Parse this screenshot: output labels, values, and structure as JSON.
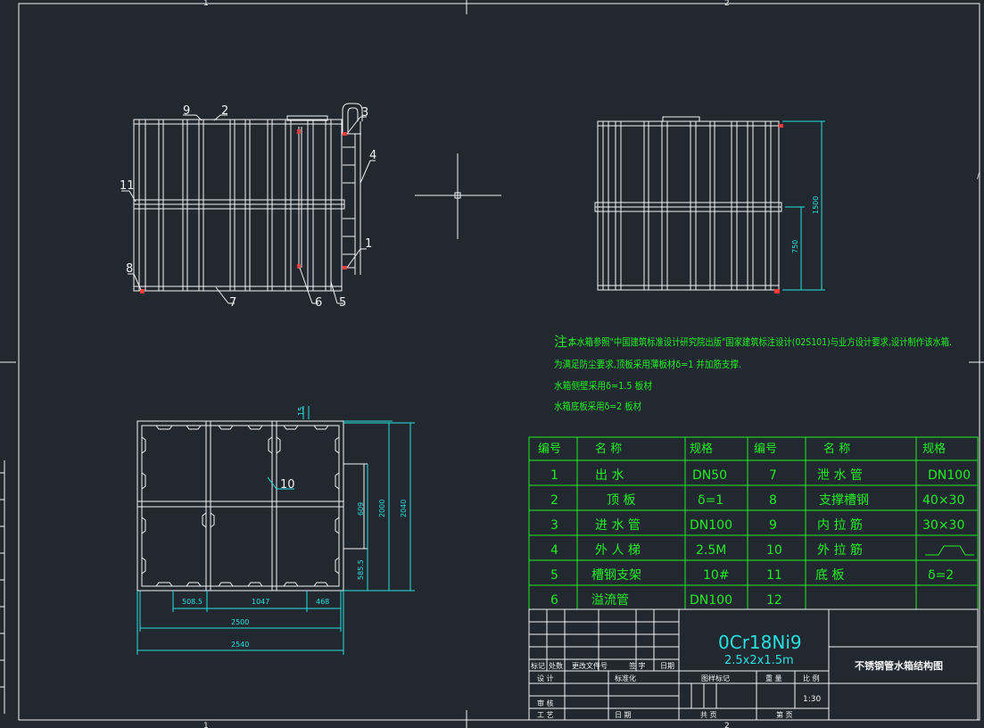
{
  "colors": {
    "background": "#212830",
    "line": "#f2f2f2",
    "dimension": "#28e0e0",
    "table": "#22ee22",
    "marker": "#ff3b3b"
  },
  "frame_zone_labels": {
    "top_left": "1",
    "top_right": "2",
    "bottom_left": "1",
    "bottom_right": "2",
    "right_side": "/"
  },
  "front_view": {
    "callouts": [
      "9",
      "2",
      "3",
      "4",
      "11",
      "1",
      "8",
      "7",
      "6",
      "5"
    ]
  },
  "side_view": {
    "dim_total": "1500",
    "dim_lower": "750"
  },
  "plan_view": {
    "dim_top": "15",
    "callout": "10",
    "dim_609": "609",
    "dim_2000": "2000",
    "dim_2040": "2040",
    "dim_585": "585.5",
    "dim_508": "508.5",
    "dim_1047": "1047",
    "dim_468": "468",
    "dim_2500": "2500",
    "dim_2540": "2540"
  },
  "notes": {
    "prefix": "注:",
    "line1": "本水箱参照\"中国建筑标准设计研究院出版\"国家建筑标注设计(02S101)与业方设计要求,设计制作该水箱.",
    "line2": "为满足防尘要求,顶板采用薄板材δ=1  并加筋支撑.",
    "line3": "水箱侧壁采用δ=1.5  板材",
    "line4": "水箱底板采用δ=2  板材"
  },
  "parts_table": {
    "headers": [
      "编号",
      "名  称",
      "规格",
      "编号",
      "名  称",
      "规格"
    ],
    "rows": [
      [
        "1",
        "出  水",
        "DN50",
        "7",
        "泄 水 管",
        "DN100"
      ],
      [
        "2",
        "顶  板",
        "δ=1",
        "8",
        "支撑槽钢",
        "40×30"
      ],
      [
        "3",
        "进 水 管",
        "DN100",
        "9",
        "内 拉 筋",
        "30×30"
      ],
      [
        "4",
        "外 人 梯",
        "2.5M",
        "10",
        "外 拉 筋",
        ""
      ],
      [
        "5",
        "槽钢支架",
        "10#",
        "11",
        "底  板",
        "δ=2"
      ],
      [
        "6",
        "溢流管",
        "DN100",
        "12",
        "",
        ""
      ]
    ]
  },
  "title_block": {
    "material": "0Cr18Ni9",
    "size": "2.5x2x1.5m",
    "title": "不锈钢管水箱结构图",
    "rev_headers": [
      "标记",
      "处数",
      "更改文件号",
      "签 字",
      "日期"
    ],
    "design": "设 计",
    "standard": "标准化",
    "review": "审 核",
    "process": "工 艺",
    "date": "日 期",
    "stage": "图样标记",
    "weight": "重 量",
    "scale": "比 例",
    "scale_value": "1:30",
    "sheet": "共    页",
    "page": "第    页"
  }
}
